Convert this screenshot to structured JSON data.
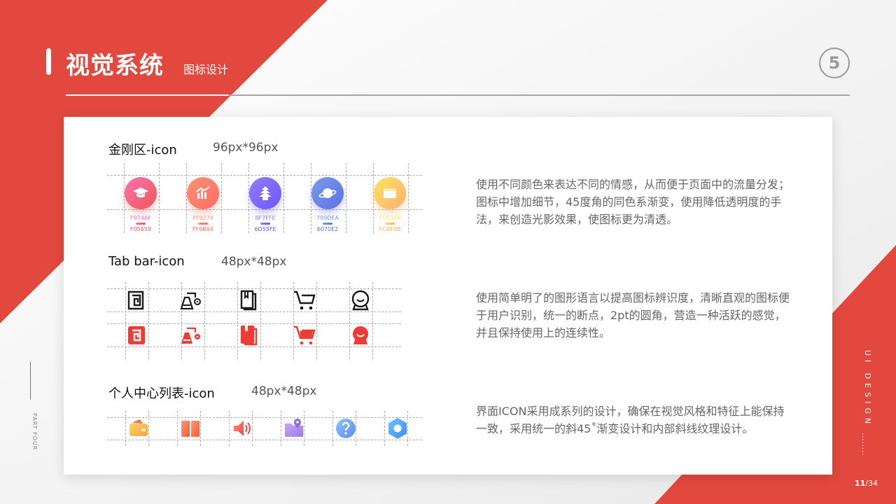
{
  "header": {
    "title": "视觉系统",
    "subtitle": "图标设计",
    "page_badge": "5"
  },
  "sections": {
    "kingkong": {
      "title": "金刚区-icon",
      "size": "96px*96px",
      "description": "使用不同颜色来表达不同的情感，从而便于页面中的流量分发；图标中增加细节，45度角的同色系渐变，使用降低透明度的手法，来创造光影效果，使图标更为清透。",
      "icons": [
        {
          "name": "graduation-cap-icon",
          "color_top": "F974AF",
          "color_bottom": "F05659",
          "top": "#F974AF",
          "bottom": "#F05659"
        },
        {
          "name": "chart-icon",
          "color_top": "FF9274",
          "color_bottom": "FF6B64",
          "top": "#FF9274",
          "bottom": "#FF6B64"
        },
        {
          "name": "temple-icon",
          "color_top": "8F7FFE",
          "color_bottom": "6D55FE",
          "top": "#8F7FFE",
          "bottom": "#6D55FE"
        },
        {
          "name": "planet-icon",
          "color_top": "799DEA",
          "color_bottom": "6070E2",
          "top": "#799DEA",
          "bottom": "#6070E2"
        },
        {
          "name": "card-icon",
          "color_top": "FCE366",
          "color_bottom": "FCAF6B",
          "top": "#FCE366",
          "bottom": "#FCAF6B"
        }
      ]
    },
    "tabbar": {
      "title": "Tab bar-icon",
      "size": "48px*48px",
      "description": "使用简单明了的图形语言以提高图标辨识度，清晰直观的图标便于用户识别，统一的断点，2pt的圆角，营造一种活跃的感觉，并且保持使用上的连续性。",
      "icons": [
        "home-icon",
        "flask-icon",
        "book-icon",
        "cart-icon",
        "profile-icon"
      ]
    },
    "personal": {
      "title": "个人中心列表-icon",
      "size": "48px*48px",
      "description": "界面ICON采用成系列的设计，确保在视觉风格和特征上能保持一致，采用统一的斜45˚渐变设计和内部斜线纹理设计。",
      "icons": [
        "wallet-icon",
        "book-open-icon",
        "speaker-icon",
        "location-folder-icon",
        "help-icon",
        "settings-icon"
      ]
    }
  },
  "side": {
    "left": "PART FOUR",
    "right": "UI DESIGN",
    "dots": "........",
    "page_current": "11",
    "page_total": "/34"
  },
  "colors": {
    "brand_red": "#E3483E",
    "tab_active": "#EE3B35",
    "tab_inactive": "#1a1a1a"
  }
}
